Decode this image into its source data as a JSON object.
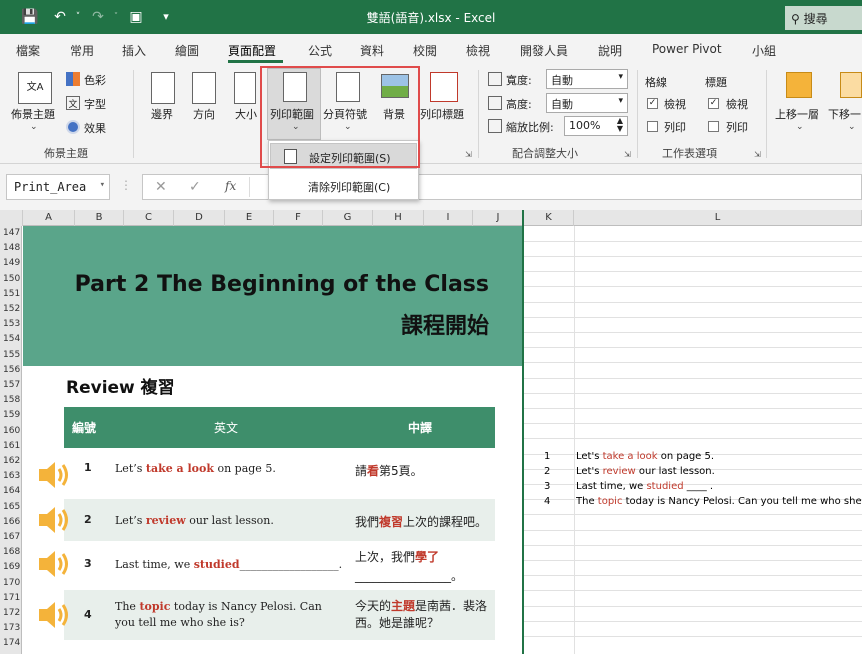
{
  "window": {
    "title": "雙語(語音).xlsx  -  Excel",
    "search_label": "搜尋"
  },
  "colors": {
    "accent": "#217346",
    "banner": "#5aa58a",
    "table_header": "#3e8e6b",
    "highlight": "#c0392b",
    "speaker": "#f4b33a"
  },
  "tabs": [
    "檔案",
    "常用",
    "插入",
    "繪圖",
    "頁面配置",
    "公式",
    "資料",
    "校閱",
    "檢視",
    "開發人員",
    "說明",
    "Power Pivot",
    "小組"
  ],
  "active_tab": "頁面配置",
  "ribbon": {
    "theme_group": {
      "name": "佈景主題",
      "theme_button": "佈景主題",
      "colors": "色彩",
      "fonts": "字型",
      "effects": "效果"
    },
    "page_setup": {
      "margins": "邊界",
      "orientation": "方向",
      "size": "大小",
      "print_area": "列印範圍",
      "breaks": "分頁符號",
      "background": "背景",
      "print_titles": "列印標題"
    },
    "scale_group": {
      "name": "配合調整大小",
      "width_label": "寬度:",
      "width_value": "自動",
      "height_label": "高度:",
      "height_value": "自動",
      "scale_label": "縮放比例:",
      "scale_value": "100%"
    },
    "sheet_options": {
      "name": "工作表選項",
      "gridlines": "格線",
      "headings": "標題",
      "view": "檢視",
      "print": "列印"
    },
    "arrange": {
      "bring_forward": "上移一層",
      "send_backward": "下移一"
    }
  },
  "print_area_menu": {
    "set": "設定列印範圍(S)",
    "clear": "清除列印範圍(C)"
  },
  "formula_bar": {
    "name_box": "Print_Area",
    "fx": "fx",
    "cancel": "✕",
    "enter": "✓"
  },
  "columns": [
    "A",
    "B",
    "C",
    "D",
    "E",
    "F",
    "G",
    "H",
    "I",
    "J",
    "K",
    "L"
  ],
  "rows": [
    "147",
    "148",
    "149",
    "150",
    "151",
    "152",
    "153",
    "154",
    "155",
    "156",
    "157",
    "158",
    "159",
    "160",
    "161",
    "162",
    "163",
    "164",
    "165",
    "166",
    "167",
    "168",
    "169",
    "170",
    "171",
    "172",
    "173",
    "174"
  ],
  "sheet": {
    "title_en": "Part 2  The Beginning of the Class",
    "title_zh": "課程開始",
    "review": "Review 複習",
    "headers": {
      "num": "編號",
      "en": "英文",
      "zh": "中譯"
    },
    "items": [
      {
        "num": "1",
        "en_pre": "Let’s ",
        "en_hl": "take a look",
        "en_post": " on page 5.",
        "zh_pre": "請",
        "zh_hl": "看",
        "zh_post": "第5頁。"
      },
      {
        "num": "2",
        "en_pre": "Let’s ",
        "en_hl": "review",
        "en_post": " our last lesson.",
        "zh_pre": "我們",
        "zh_hl": "複習",
        "zh_post": "上次的課程吧。"
      },
      {
        "num": "3",
        "en_pre": "Last time, we ",
        "en_hl": "studied",
        "en_post": "__________________.",
        "zh_pre": "上次，我們",
        "zh_hl": "學了",
        "zh_post": "________________。"
      },
      {
        "num": "4",
        "en_pre": "The ",
        "en_hl": "topic",
        "en_post": " today is Nancy Pelosi. Can you tell me who she is?",
        "zh_pre": "今天的",
        "zh_hl": "主題",
        "zh_post": "是南茜．裴洛西。她是誰呢？"
      }
    ]
  },
  "grid_data": [
    {
      "k": "1",
      "pre": "Let's ",
      "hl": "take a look",
      "post": " on page 5."
    },
    {
      "k": "2",
      "pre": "Let's ",
      "hl": "review",
      "post": " our last lesson."
    },
    {
      "k": "3",
      "pre": "Last time, we ",
      "hl": "studied",
      "post": "  ____ ."
    },
    {
      "k": "4",
      "pre": "The ",
      "hl": "topic",
      "post": "  today is Nancy Pelosi. Can you tell me who she is"
    }
  ]
}
